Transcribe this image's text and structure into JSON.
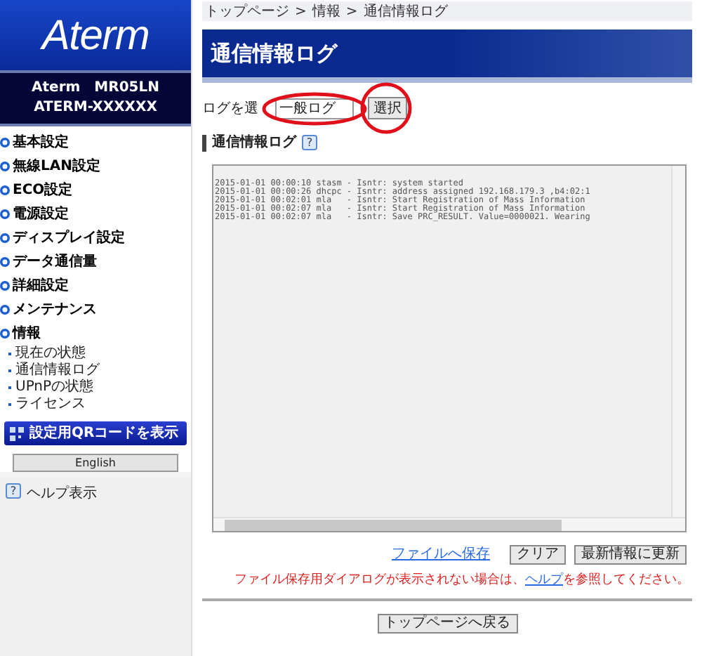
{
  "sidebar": {
    "logo": "Aterm",
    "model": "Aterm　MR05LN",
    "device_name": "ATERM-XXXXXX",
    "menu": [
      {
        "label": "基本設定"
      },
      {
        "label": "無線LAN設定"
      },
      {
        "label": "ECO設定"
      },
      {
        "label": "電源設定"
      },
      {
        "label": "ディスプレイ設定"
      },
      {
        "label": "データ通信量"
      },
      {
        "label": "詳細設定"
      },
      {
        "label": "メンテナンス"
      },
      {
        "label": "情報",
        "children": [
          {
            "label": "現在の状態"
          },
          {
            "label": "通信情報ログ"
          },
          {
            "label": "UPnPの状態"
          },
          {
            "label": "ライセンス"
          }
        ]
      }
    ],
    "qr_button": "設定用QRコードを表示",
    "language_button": "English",
    "help_icon": "?",
    "help_link": "ヘルプ表示"
  },
  "breadcrumb": [
    "トップページ",
    "情報",
    "通信情報ログ"
  ],
  "breadcrumb_separator": ">",
  "page_title": "通信情報ログ",
  "log_select": {
    "label": "ログを選",
    "value": "一般ログ",
    "button": "選択"
  },
  "section_title": "通信情報ログ",
  "section_help": "?",
  "log_lines": [
    "2015-01-01 00:00:10 stasm - Isntr: system started",
    "2015-01-01 00:00:26 dhcpc - Isntr: address assigned 192.168.179.3 ,b4:02:1",
    "2015-01-01 00:02:01 mla   - Isntr: Start Registration of Mass Information",
    "2015-01-01 00:02:07 mla   - Isntr: Start Registration of Mass Information",
    "2015-01-01 00:02:07 mla   - Isntr: Save PRC_RESULT. Value=0000021. Wearing"
  ],
  "actions": {
    "save_link": "ファイルへ保存",
    "clear_button": "クリア",
    "refresh_button": "最新情報に更新"
  },
  "note": {
    "before": "ファイル保存用ダイアログが表示されない場合は、",
    "link": "ヘルプ",
    "after": "を参照してください。"
  },
  "back_button": "トップページへ戻る"
}
